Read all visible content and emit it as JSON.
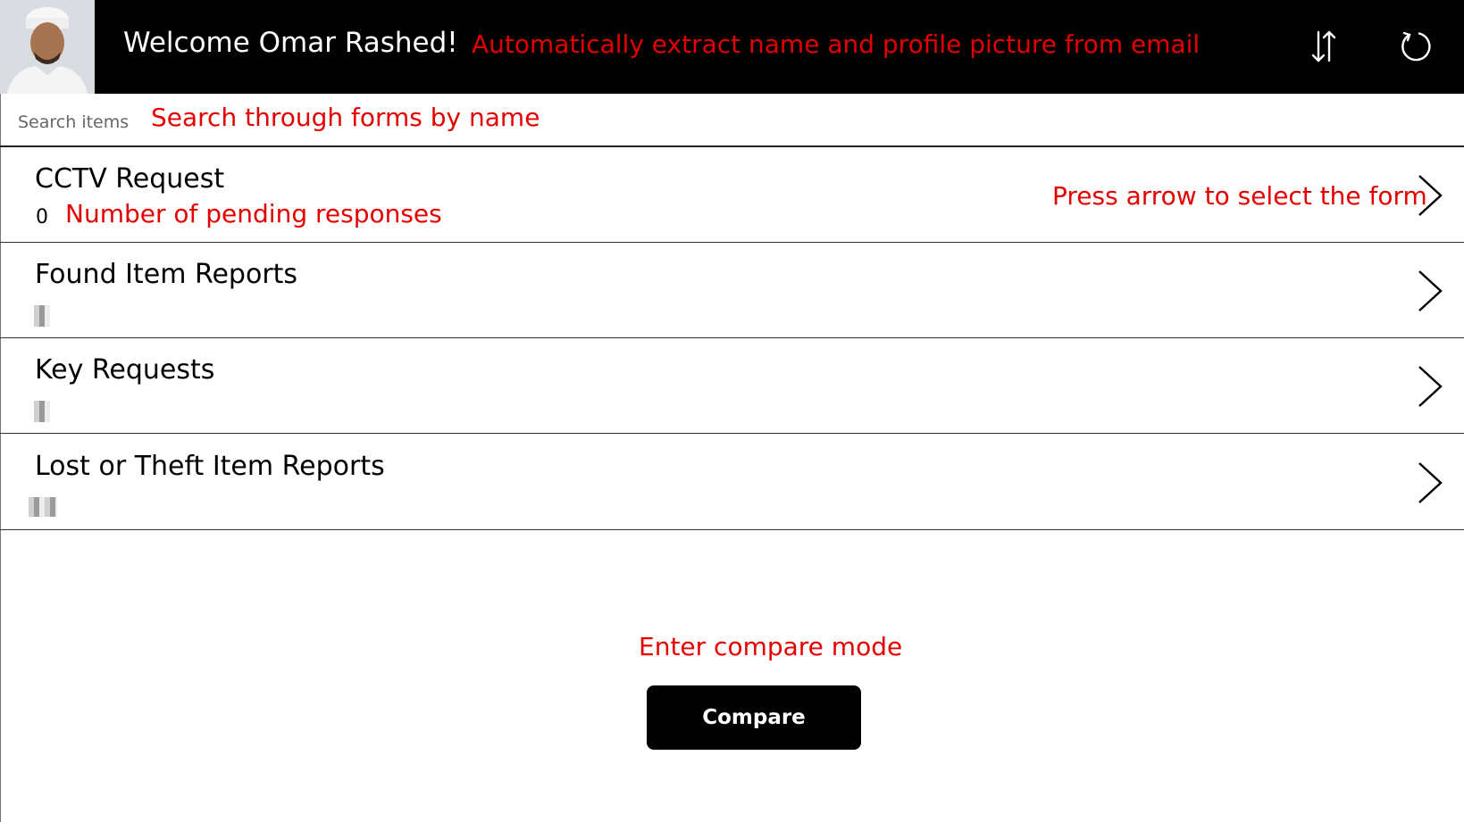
{
  "header": {
    "welcome_text": "Welcome Omar Rashed!",
    "annotation": "Automatically extract name and profile picture from email",
    "sort_icon": "sort-arrows-icon",
    "refresh_icon": "refresh-icon"
  },
  "search": {
    "placeholder": "Search items",
    "annotation": "Search through forms by name"
  },
  "forms": [
    {
      "title": "CCTV Request",
      "pending_count": "0"
    },
    {
      "title": "Found Item Reports",
      "pending_count": ""
    },
    {
      "title": "Key Requests",
      "pending_count": ""
    },
    {
      "title": "Lost or Theft Item Reports",
      "pending_count": ""
    }
  ],
  "annotations": {
    "pending": "Number of pending responses",
    "arrow": "Press arrow to select the form",
    "compare": "Enter compare mode"
  },
  "compare": {
    "label": "Compare"
  },
  "colors": {
    "header_bg": "#000000",
    "annotation": "#e40000",
    "button_bg": "#000000"
  }
}
